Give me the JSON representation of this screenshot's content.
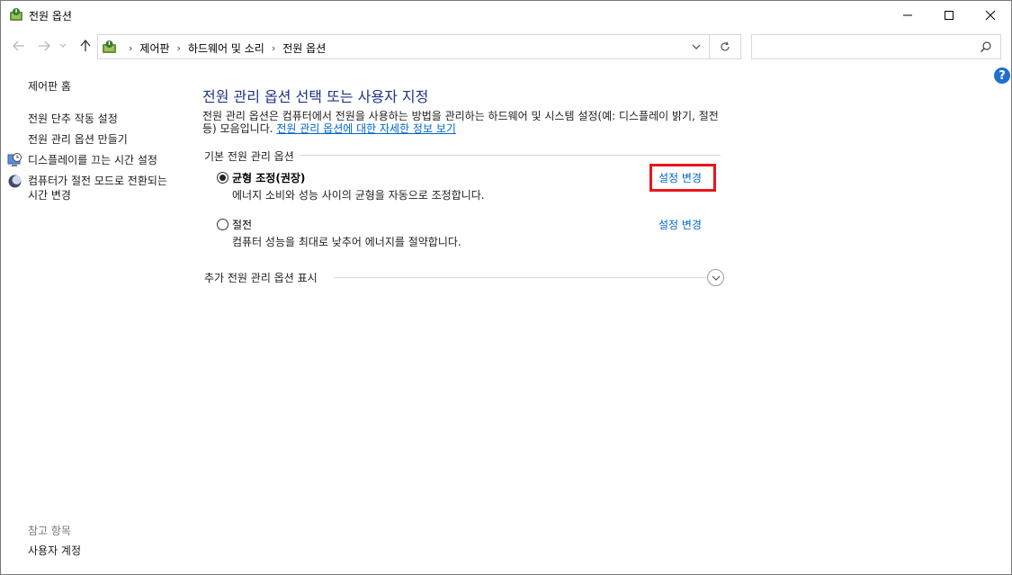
{
  "window": {
    "title": "전원 옵션",
    "minimize_icon": "minimize-icon",
    "maximize_icon": "maximize-icon",
    "close_icon": "close-icon"
  },
  "address_bar": {
    "breadcrumbs": [
      "제어판",
      "하드웨어 및 소리",
      "전원 옵션"
    ],
    "search_placeholder": ""
  },
  "sidebar": {
    "home": "제어판 홈",
    "links": [
      "전원 단추 작동 설정",
      "전원 관리 옵션 만들기",
      "디스플레이를 끄는 시간 설정",
      "컴퓨터가 절전 모드로 전환되는 시간 변경"
    ],
    "see_also_label": "참고 항목",
    "see_also_links": [
      "사용자 계정"
    ]
  },
  "main": {
    "title": "전원 관리 옵션 선택 또는 사용자 지정",
    "description": "전원 관리 옵션은 컴퓨터에서 전원을 사용하는 방법을 관리하는 하드웨어 및 시스템 설정(예: 디스플레이 밝기, 절전 등) 모음입니다. ",
    "description_link": "전원 관리 옵션에 대한 자세한 정보 보기",
    "group_title": "기본 전원 관리 옵션",
    "plans": [
      {
        "name": "균형 조정(권장)",
        "description": "에너지 소비와 성능 사이의 균형을 자동으로 조정합니다.",
        "selected": true,
        "change_label": "설정 변경"
      },
      {
        "name": "절전",
        "description": "컴퓨터 성능을 최대로 낮추어 에너지를 절약합니다.",
        "selected": false,
        "change_label": "설정 변경"
      }
    ],
    "more_plans_label": "추가 전원 관리 옵션 표시"
  },
  "colors": {
    "title_blue": "#1e3287",
    "link_blue": "#0066cc",
    "highlight_red": "#e8151c"
  }
}
